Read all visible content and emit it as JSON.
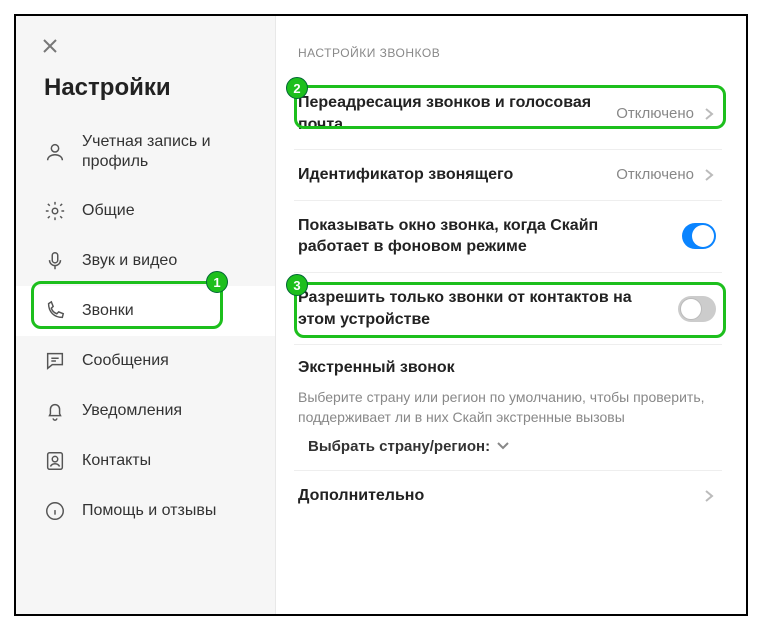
{
  "sidebar": {
    "title": "Настройки",
    "items": [
      {
        "label": "Учетная запись и профиль"
      },
      {
        "label": "Общие"
      },
      {
        "label": "Звук и видео"
      },
      {
        "label": "Звонки"
      },
      {
        "label": "Сообщения"
      },
      {
        "label": "Уведомления"
      },
      {
        "label": "Контакты"
      },
      {
        "label": "Помощь и отзывы"
      }
    ]
  },
  "main": {
    "section_title": "НАСТРОЙКИ ЗВОНКОВ",
    "forwarding": {
      "label": "Переадресация звонков и голосовая почта",
      "value": "Отключено"
    },
    "caller_id": {
      "label": "Идентификатор звонящего",
      "value": "Отключено"
    },
    "bg_window": {
      "label": "Показывать окно звонка, когда Скайп работает в фоновом режиме"
    },
    "contacts_only": {
      "label": "Разрешить только звонки от контактов на этом устройстве"
    },
    "emergency": {
      "title": "Экстренный звонок",
      "desc": "Выберите страну или регион по умолчанию, чтобы проверить, поддерживает ли в них Скайп экстренные вызовы",
      "select": "Выбрать страну/регион:"
    },
    "more": {
      "label": "Дополнительно"
    }
  },
  "annotations": {
    "a1": "1",
    "a2": "2",
    "a3": "3"
  }
}
